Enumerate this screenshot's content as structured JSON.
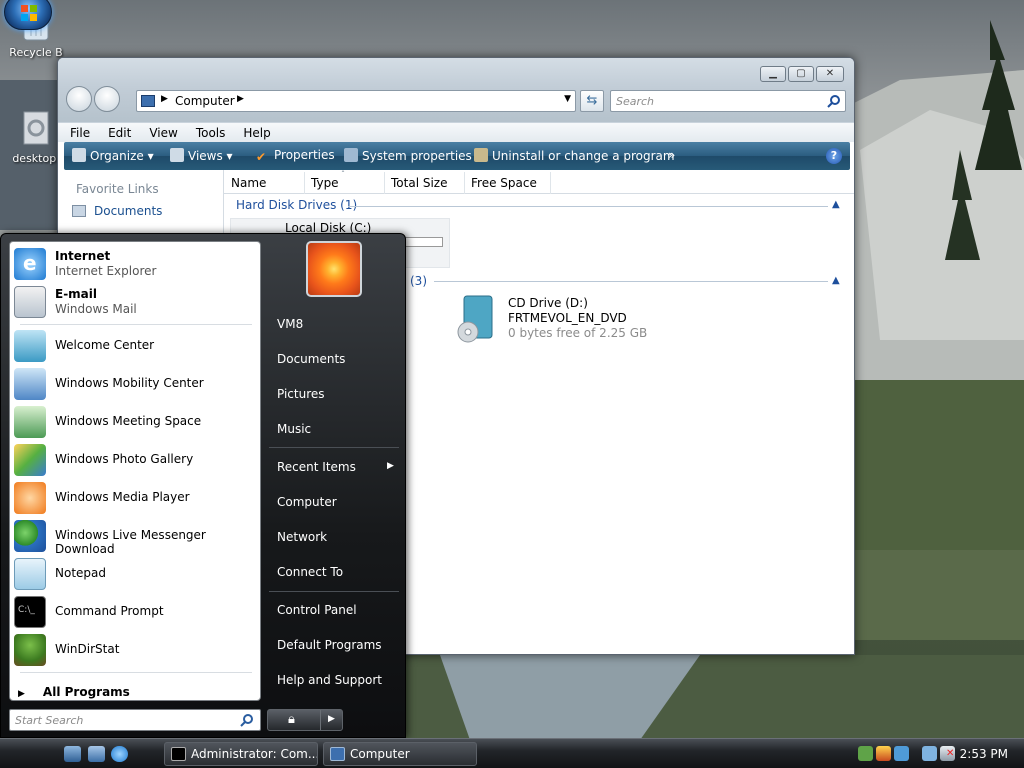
{
  "desktop": {
    "icons": [
      {
        "label": "Recycle B",
        "icon": "recycle-bin-icon"
      },
      {
        "label": "desktop.",
        "icon": "settings-file-icon"
      }
    ]
  },
  "explorer": {
    "address": "Computer",
    "search_placeholder": "Search",
    "menu": [
      "File",
      "Edit",
      "View",
      "Tools",
      "Help"
    ],
    "commands": [
      "Organize",
      "Views",
      "Properties",
      "System properties",
      "Uninstall or change a program"
    ],
    "more": "»",
    "help": "?",
    "favorite_links_label": "Favorite Links",
    "favorite_links": [
      "Documents"
    ],
    "columns": [
      "Name",
      "Type",
      "Total Size",
      "Free Space"
    ],
    "groups": [
      {
        "label": "Hard Disk Drives (1)"
      },
      {
        "label": "(3)"
      }
    ],
    "drives": [
      {
        "name": "Local Disk (C:)",
        "fill": 0.0
      },
      {
        "name": "CD Drive (D:)",
        "label": "FRTMEVOL_EN_DVD",
        "info": "0 bytes free of 2.25 GB"
      }
    ]
  },
  "start_menu": {
    "pinned": [
      {
        "title": "Internet",
        "subtitle": "Internet Explorer",
        "icon": "internet-explorer-icon"
      },
      {
        "title": "E-mail",
        "subtitle": "Windows Mail",
        "icon": "windows-mail-icon"
      }
    ],
    "recent": [
      {
        "label": "Welcome Center",
        "icon": "welcome-center-icon"
      },
      {
        "label": "Windows Mobility Center",
        "icon": "mobility-center-icon"
      },
      {
        "label": "Windows Meeting Space",
        "icon": "meeting-space-icon"
      },
      {
        "label": "Windows Photo Gallery",
        "icon": "photo-gallery-icon"
      },
      {
        "label": "Windows Media Player",
        "icon": "media-player-icon"
      },
      {
        "label": "Windows Live Messenger Download",
        "icon": "messenger-icon"
      },
      {
        "label": "Notepad",
        "icon": "notepad-icon"
      },
      {
        "label": "Command Prompt",
        "icon": "command-prompt-icon"
      },
      {
        "label": "WinDirStat",
        "icon": "windirstat-icon"
      }
    ],
    "all_programs": "All Programs",
    "search_placeholder": "Start Search",
    "right": {
      "user": "VM8",
      "items1": [
        "Documents",
        "Pictures",
        "Music"
      ],
      "items2": [
        "Recent Items",
        "Computer",
        "Network",
        "Connect To"
      ],
      "items3": [
        "Control Panel",
        "Default Programs",
        "Help and Support"
      ]
    }
  },
  "taskbar": {
    "tasks": [
      {
        "label": "Administrator: Com...",
        "icon": "command-prompt-icon"
      },
      {
        "label": "Computer",
        "icon": "computer-icon"
      }
    ],
    "clock": "2:53 PM"
  },
  "colors": {
    "command_bar": "#2b5d80",
    "link": "#1e4f9c",
    "start_menu_bg": "#17191b"
  }
}
